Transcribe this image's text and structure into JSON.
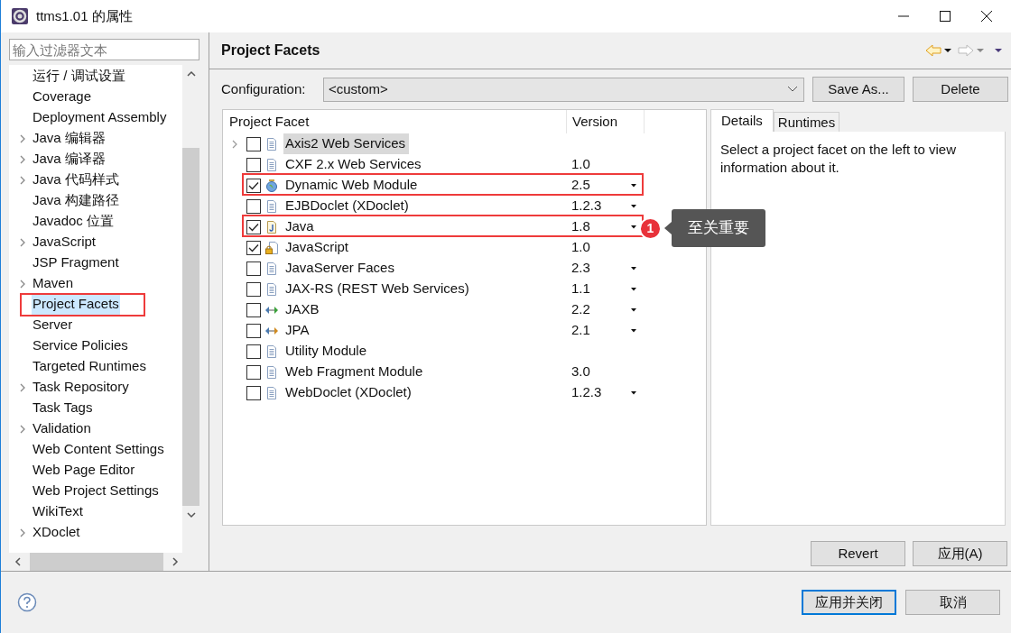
{
  "window": {
    "title": "ttms1.01 的属性"
  },
  "filter": {
    "placeholder": "输入过滤器文本"
  },
  "sidebar": {
    "items": [
      {
        "label": "运行 / 调试设置",
        "expandable": false,
        "selected": false,
        "annotated": false
      },
      {
        "label": "Coverage",
        "expandable": false,
        "selected": false,
        "annotated": false
      },
      {
        "label": "Deployment Assembly",
        "expandable": false,
        "selected": false,
        "annotated": false
      },
      {
        "label": "Java 编辑器",
        "expandable": true,
        "selected": false,
        "annotated": false
      },
      {
        "label": "Java 编译器",
        "expandable": true,
        "selected": false,
        "annotated": false
      },
      {
        "label": "Java 代码样式",
        "expandable": true,
        "selected": false,
        "annotated": false
      },
      {
        "label": "Java 构建路径",
        "expandable": false,
        "selected": false,
        "annotated": false
      },
      {
        "label": "Javadoc 位置",
        "expandable": false,
        "selected": false,
        "annotated": false
      },
      {
        "label": "JavaScript",
        "expandable": true,
        "selected": false,
        "annotated": false
      },
      {
        "label": "JSP Fragment",
        "expandable": false,
        "selected": false,
        "annotated": false
      },
      {
        "label": "Maven",
        "expandable": true,
        "selected": false,
        "annotated": false
      },
      {
        "label": "Project Facets",
        "expandable": false,
        "selected": true,
        "annotated": true
      },
      {
        "label": "Server",
        "expandable": false,
        "selected": false,
        "annotated": false
      },
      {
        "label": "Service Policies",
        "expandable": false,
        "selected": false,
        "annotated": false
      },
      {
        "label": "Targeted Runtimes",
        "expandable": false,
        "selected": false,
        "annotated": false
      },
      {
        "label": "Task Repository",
        "expandable": true,
        "selected": false,
        "annotated": false
      },
      {
        "label": "Task Tags",
        "expandable": false,
        "selected": false,
        "annotated": false
      },
      {
        "label": "Validation",
        "expandable": true,
        "selected": false,
        "annotated": false
      },
      {
        "label": "Web Content Settings",
        "expandable": false,
        "selected": false,
        "annotated": false
      },
      {
        "label": "Web Page Editor",
        "expandable": false,
        "selected": false,
        "annotated": false
      },
      {
        "label": "Web Project Settings",
        "expandable": false,
        "selected": false,
        "annotated": false
      },
      {
        "label": "WikiText",
        "expandable": false,
        "selected": false,
        "annotated": false
      },
      {
        "label": "XDoclet",
        "expandable": true,
        "selected": false,
        "annotated": false
      }
    ]
  },
  "page": {
    "title": "Project Facets"
  },
  "configuration": {
    "label": "Configuration:",
    "value": "<custom>",
    "buttons": [
      "Save As...",
      "Delete"
    ]
  },
  "table": {
    "columns": [
      "Project Facet",
      "Version"
    ],
    "rows": [
      {
        "name": "Axis2 Web Services",
        "version": "",
        "kind": "document",
        "checked": false,
        "expandable": true,
        "dropdown": false,
        "selected": true,
        "annotated": false
      },
      {
        "name": "CXF 2.x Web Services",
        "version": "1.0",
        "kind": "document",
        "checked": false,
        "expandable": false,
        "dropdown": false,
        "selected": false,
        "annotated": false
      },
      {
        "name": "Dynamic Web Module",
        "version": "2.5",
        "kind": "globe",
        "checked": true,
        "expandable": false,
        "dropdown": true,
        "selected": false,
        "annotated": true
      },
      {
        "name": "EJBDoclet (XDoclet)",
        "version": "1.2.3",
        "kind": "document",
        "checked": false,
        "expandable": false,
        "dropdown": true,
        "selected": false,
        "annotated": false
      },
      {
        "name": "Java",
        "version": "1.8",
        "kind": "java",
        "checked": true,
        "expandable": false,
        "dropdown": true,
        "selected": false,
        "annotated": true
      },
      {
        "name": "JavaScript",
        "version": "1.0",
        "kind": "locked",
        "checked": true,
        "expandable": false,
        "dropdown": false,
        "selected": false,
        "annotated": false
      },
      {
        "name": "JavaServer Faces",
        "version": "2.3",
        "kind": "document",
        "checked": false,
        "expandable": false,
        "dropdown": true,
        "selected": false,
        "annotated": false
      },
      {
        "name": "JAX-RS (REST Web Services)",
        "version": "1.1",
        "kind": "document",
        "checked": false,
        "expandable": false,
        "dropdown": true,
        "selected": false,
        "annotated": false
      },
      {
        "name": "JAXB",
        "version": "2.2",
        "kind": "arrows-green",
        "checked": false,
        "expandable": false,
        "dropdown": true,
        "selected": false,
        "annotated": false
      },
      {
        "name": "JPA",
        "version": "2.1",
        "kind": "arrows-orange",
        "checked": false,
        "expandable": false,
        "dropdown": true,
        "selected": false,
        "annotated": false
      },
      {
        "name": "Utility Module",
        "version": "",
        "kind": "document",
        "checked": false,
        "expandable": false,
        "dropdown": false,
        "selected": false,
        "annotated": false
      },
      {
        "name": "Web Fragment Module",
        "version": "3.0",
        "kind": "document",
        "checked": false,
        "expandable": false,
        "dropdown": false,
        "selected": false,
        "annotated": false
      },
      {
        "name": "WebDoclet (XDoclet)",
        "version": "1.2.3",
        "kind": "document",
        "checked": false,
        "expandable": false,
        "dropdown": true,
        "selected": false,
        "annotated": false
      }
    ]
  },
  "callout": {
    "badge": "1",
    "text": "至关重要"
  },
  "details": {
    "tabs": [
      {
        "label": "Details",
        "selected": true
      },
      {
        "label": "Runtimes",
        "selected": false
      }
    ],
    "text": "Select a project facet on the left to view information about it."
  },
  "panel_buttons": [
    "Revert",
    "应用(A)"
  ],
  "dialog_buttons": [
    {
      "label": "应用并关闭",
      "default": true
    },
    {
      "label": "取消",
      "default": false
    }
  ]
}
